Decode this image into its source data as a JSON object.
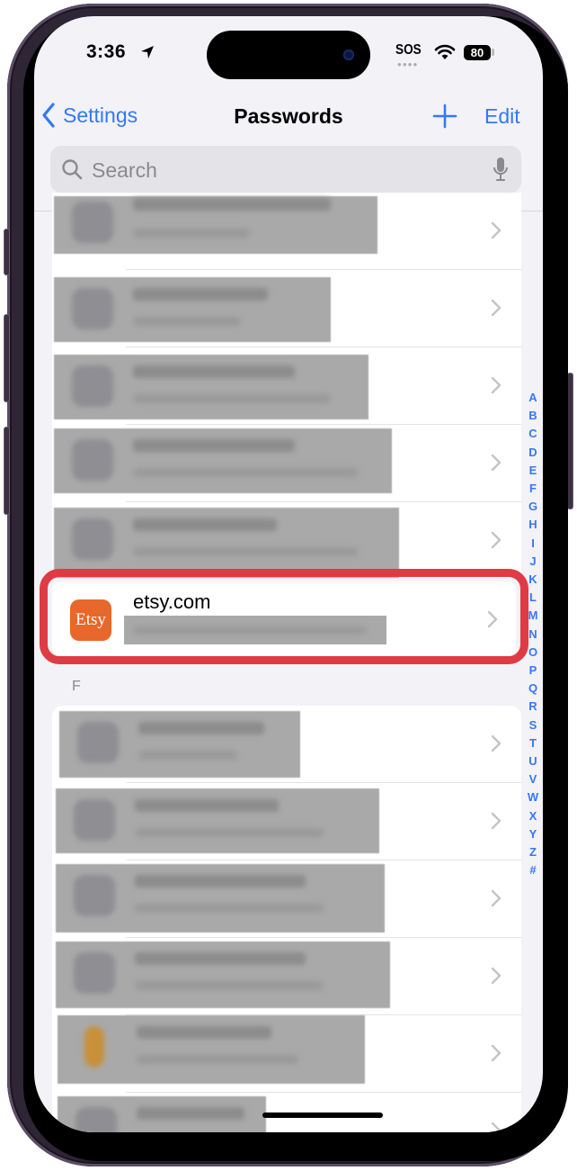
{
  "status_bar": {
    "time": "3:36",
    "carrier": "SOS",
    "battery": "80",
    "icons": [
      "location-arrow-icon",
      "wifi-icon",
      "battery-icon"
    ]
  },
  "nav": {
    "back_label": "Settings",
    "title": "Passwords",
    "add_icon": "plus-icon",
    "edit_label": "Edit"
  },
  "search": {
    "placeholder": "Search",
    "value": ""
  },
  "list_top": [
    {
      "domain": "[blurred]",
      "username": "[blurred]"
    },
    {
      "domain": "[blurred]",
      "username": "[blurred]"
    },
    {
      "domain": "[blurred]",
      "username": "[blurred]"
    },
    {
      "domain": "[blurred]",
      "username": "[blurred]"
    },
    {
      "domain": "[blurred]",
      "username": "[blurred]"
    }
  ],
  "highlighted_item": {
    "logo_text": "Etsy",
    "domain": "etsy.com",
    "username": "[blurred]",
    "highlight_color": "#de3b45",
    "logo_color": "#e8672a"
  },
  "section_f": {
    "header": "F",
    "items": [
      {
        "domain": "[blurred]",
        "username": "[blurred]"
      },
      {
        "domain": "[blurred]",
        "username": "[blurred]"
      },
      {
        "domain": "[blurred]",
        "username": "[blurred]"
      },
      {
        "domain": "[blurred]",
        "username": "[blurred]"
      },
      {
        "domain": "[blurred]",
        "username": "[blurred]"
      },
      {
        "domain": "[blurred]",
        "username": "[blurred]"
      }
    ]
  },
  "index_letters": [
    "A",
    "B",
    "C",
    "D",
    "E",
    "F",
    "G",
    "H",
    "I",
    "J",
    "K",
    "L",
    "M",
    "N",
    "O",
    "P",
    "Q",
    "R",
    "S",
    "T",
    "U",
    "V",
    "W",
    "X",
    "Y",
    "Z",
    "#"
  ],
  "accent_color": "#3478f6"
}
